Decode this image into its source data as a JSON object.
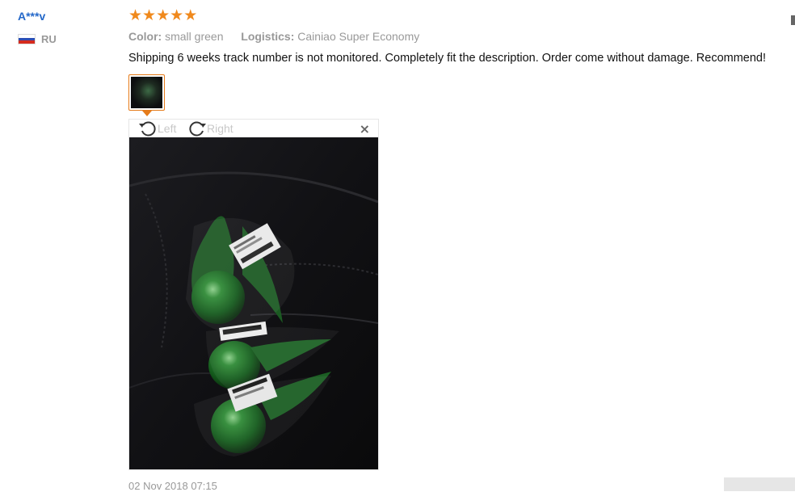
{
  "reviewer": {
    "name": "A***v",
    "country_code": "RU",
    "flag_colors": [
      "#ffffff",
      "#2c4fb5",
      "#d52b1e"
    ]
  },
  "rating": {
    "stars": 5,
    "max": 5,
    "color": "#f0891c"
  },
  "attributes": {
    "color_label": "Color:",
    "color_value": "small green",
    "logistics_label": "Logistics:",
    "logistics_value": "Cainiao Super Economy"
  },
  "review_text": "Shipping 6 weeks track number is not monitored. Completely fit the description. Order come without damage. Recommend!",
  "viewer": {
    "rotate_left_label": "Left",
    "rotate_right_label": "Right",
    "close_symbol": "×",
    "icons": [
      "rotate-left-icon",
      "rotate-right-icon",
      "close-icon"
    ]
  },
  "timestamp": "02 Nov 2018 07:15",
  "accent_color": "#e57b1a",
  "link_color": "#2468c9"
}
